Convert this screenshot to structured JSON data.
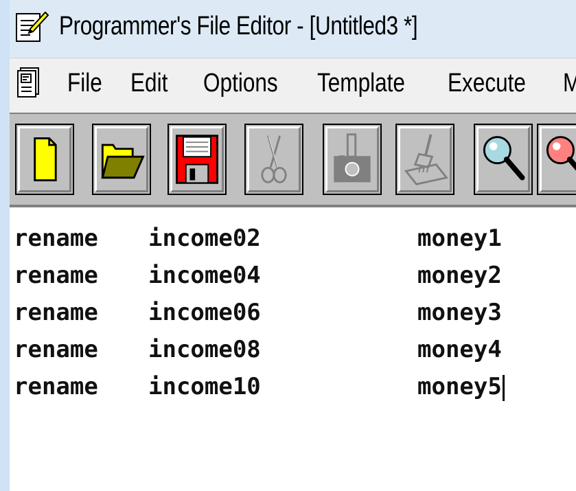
{
  "window": {
    "title": "Programmer's File Editor - [Untitled3 *]",
    "app_icon": "notepad-pencil-icon"
  },
  "menubar": {
    "doc_icon": "document-icon",
    "items": [
      "File",
      "Edit",
      "Options",
      "Template",
      "Execute",
      "M"
    ]
  },
  "toolbar": {
    "buttons": [
      {
        "name": "new-file-button",
        "icon": "new-document-icon",
        "enabled": true
      },
      {
        "name": "open-file-button",
        "icon": "open-folder-icon",
        "enabled": true
      },
      {
        "name": "save-file-button",
        "icon": "floppy-disk-icon",
        "enabled": true
      },
      {
        "name": "cut-button",
        "icon": "scissors-icon",
        "enabled": false
      },
      {
        "name": "copy-button",
        "icon": "camera-icon",
        "enabled": false
      },
      {
        "name": "paste-button",
        "icon": "brush-icon",
        "enabled": false
      },
      {
        "name": "find-button",
        "icon": "magnifier-icon",
        "enabled": true
      },
      {
        "name": "find-next-button",
        "icon": "magnifier-red-icon",
        "enabled": true
      }
    ]
  },
  "editor": {
    "lines": [
      {
        "cmd": "rename",
        "old": "income02",
        "new": "money1"
      },
      {
        "cmd": "rename",
        "old": "income04",
        "new": "money2"
      },
      {
        "cmd": "rename",
        "old": "income06",
        "new": "money3"
      },
      {
        "cmd": "rename",
        "old": "income08",
        "new": "money4"
      },
      {
        "cmd": "rename",
        "old": "income10",
        "new": "money5"
      }
    ]
  },
  "colors": {
    "titlebar_bg": "#ddeaf6",
    "toolbar_bg": "#c0c0c0",
    "new_file_yellow": "#ffff00",
    "folder_olive": "#808000",
    "floppy_red": "#ff0000"
  }
}
